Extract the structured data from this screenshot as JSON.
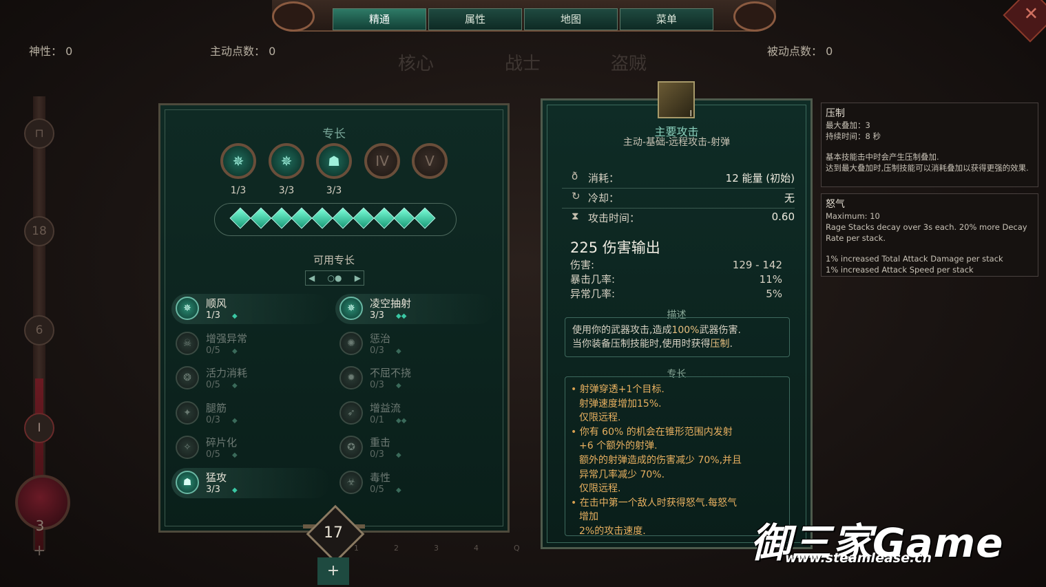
{
  "nav": {
    "tabs": [
      {
        "label": "精通",
        "active": true
      },
      {
        "label": "属性",
        "active": false
      },
      {
        "label": "地图",
        "active": false
      },
      {
        "label": "菜单",
        "active": false
      }
    ]
  },
  "stats": {
    "divinity_label": "神性：",
    "divinity_value": "0",
    "active_points_label": "主动点数：",
    "active_points_value": "0",
    "passive_points_label": "被动点数：",
    "passive_points_value": "0"
  },
  "categories": [
    "核心",
    "战士",
    "盗贼"
  ],
  "level_bar": {
    "nodes": [
      "18",
      "6",
      "I"
    ],
    "orb_value": "3",
    "plus": "+"
  },
  "specialization": {
    "title": "专长",
    "mastery_nodes": [
      {
        "label": "1/3",
        "glyph": "✵",
        "locked": false
      },
      {
        "label": "3/3",
        "glyph": "✵",
        "locked": false
      },
      {
        "label": "3/3",
        "glyph": "☗",
        "locked": false
      },
      {
        "label": "",
        "glyph": "IV",
        "locked": true
      },
      {
        "label": "",
        "glyph": "V",
        "locked": true
      }
    ],
    "gem_count": 10,
    "available_title": "可用专长",
    "points_remaining": "17",
    "points_plus": "+",
    "hotkeys": [
      "1",
      "2",
      "3",
      "4",
      "Q"
    ],
    "items_left": [
      {
        "name": "顺风",
        "count": "1/3",
        "pips": "◆",
        "active": true,
        "glyph": "✵"
      },
      {
        "name": "增强异常",
        "count": "0/5",
        "pips": "◆",
        "active": false,
        "glyph": "☠"
      },
      {
        "name": "活力消耗",
        "count": "0/5",
        "pips": "◆",
        "active": false,
        "glyph": "❂"
      },
      {
        "name": "腿筋",
        "count": "0/3",
        "pips": "◆",
        "active": false,
        "glyph": "✦"
      },
      {
        "name": "碎片化",
        "count": "0/5",
        "pips": "◆",
        "active": false,
        "glyph": "✧"
      },
      {
        "name": "猛攻",
        "count": "3/3",
        "pips": "◆",
        "active": true,
        "glyph": "☗"
      }
    ],
    "items_right": [
      {
        "name": "凌空抽射",
        "count": "3/3",
        "pips": "◆◆",
        "active": true,
        "glyph": "✵"
      },
      {
        "name": "惩治",
        "count": "0/3",
        "pips": "◆",
        "active": false,
        "glyph": "✺"
      },
      {
        "name": "不屈不挠",
        "count": "0/3",
        "pips": "◆",
        "active": false,
        "glyph": "✹"
      },
      {
        "name": "增益流",
        "count": "0/1",
        "pips": "◆◆",
        "active": false,
        "glyph": "➶"
      },
      {
        "name": "重击",
        "count": "0/3",
        "pips": "◆",
        "active": false,
        "glyph": "✪"
      },
      {
        "name": "毒性",
        "count": "0/5",
        "pips": "◆",
        "active": false,
        "glyph": "☣"
      }
    ]
  },
  "skill": {
    "icon_numeral": "I",
    "title": "主要攻击",
    "subtitle": "主动-基础-远程攻击-射弹",
    "cost_label": "消耗：",
    "cost_value": "12 能量 (初始)",
    "cooldown_label": "冷却：",
    "cooldown_value": "无",
    "attack_time_label": "攻击时间：",
    "attack_time_value": "0.60",
    "damage_output": "225 伤害输出",
    "damage_label": "伤害:",
    "damage_value": "129 - 142",
    "crit_label": "暴击几率:",
    "crit_value": "11%",
    "anomaly_label": "异常几率:",
    "anomaly_value": "5%",
    "desc_title": "描述",
    "desc_line1_pre": "使用你的武器攻击,造成",
    "desc_line1_highlight": "100%",
    "desc_line1_post": "武器伤害.",
    "desc_line2_pre": "当你装备压制技能时,使用时获得",
    "desc_line2_highlight": "压制",
    "desc_line2_post": ".",
    "spec_title": "专长",
    "spec_bullets": [
      {
        "bullet": true,
        "text": "射弹穿透+1个目标."
      },
      {
        "bullet": false,
        "text": "射弹速度增加15%."
      },
      {
        "bullet": false,
        "text": "仅限远程."
      },
      {
        "bullet": true,
        "text": "你有 60% 的机会在锥形范围内发射"
      },
      {
        "bullet": false,
        "text": "+6 个额外的射弹."
      },
      {
        "bullet": false,
        "text": "额外的射弹造成的伤害减少 70%,并且"
      },
      {
        "bullet": false,
        "text": "异常几率减少 70%."
      },
      {
        "bullet": false,
        "text": "仅限远程."
      },
      {
        "bullet": true,
        "text": "在击中第一个敌人时获得怒气.每怒气"
      },
      {
        "bullet": false,
        "text": "增加"
      },
      {
        "bullet": false,
        "text": "2%的攻击速度."
      }
    ]
  },
  "tooltips": [
    {
      "title": "压制",
      "lines": [
        "最大叠加：3",
        "持续时间：8 秒",
        "",
        "基本技能击中时会产生压制叠加.",
        "达到最大叠加时,压制技能可以消耗叠加以获得更强的效果."
      ]
    },
    {
      "title": "怒气",
      "lines": [
        "Maximum: 10",
        "Rage Stacks decay over 3s each. 20% more Decay Rate per stack.",
        "",
        "1% increased Total Attack Damage per stack",
        "1% increased Attack Speed per stack"
      ]
    }
  ],
  "watermark": {
    "brand": "御三家Game",
    "url": "www.steamlease.cn"
  },
  "close_glyph": "✕"
}
